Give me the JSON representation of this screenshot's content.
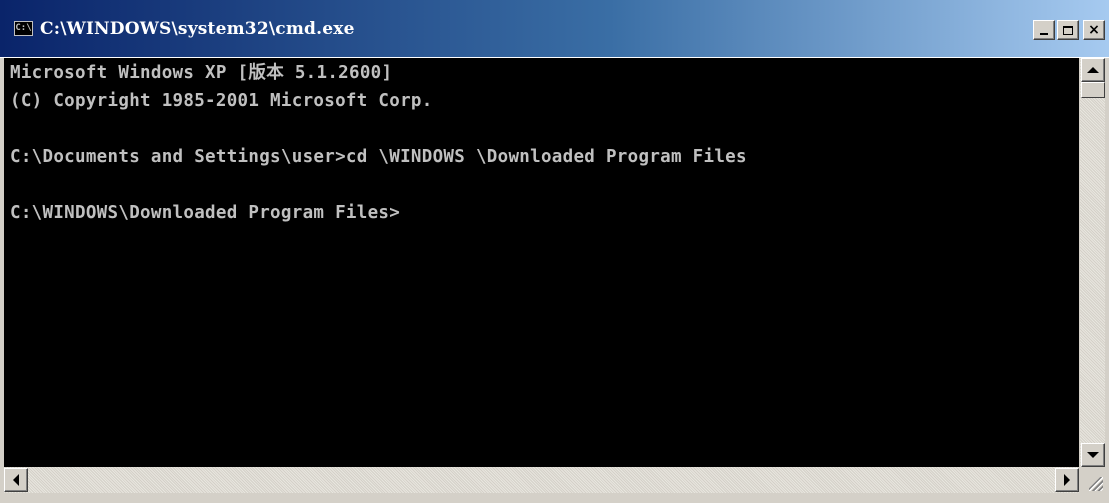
{
  "window": {
    "title": "C:\\WINDOWS\\system32\\cmd.exe",
    "app_icon_label": "C:\\"
  },
  "titlebar": {
    "minimize_icon": "minimize-icon",
    "maximize_icon": "maximize-icon",
    "close_symbol": "×"
  },
  "console": {
    "lines": [
      "Microsoft Windows XP [版本 5.1.2600]",
      "(C) Copyright 1985-2001 Microsoft Corp.",
      "",
      "C:\\Documents and Settings\\user>cd \\WINDOWS \\Downloaded Program Files",
      "",
      "C:\\WINDOWS\\Downloaded Program Files>"
    ],
    "text_color": "#c0c0c0",
    "background_color": "#000000"
  },
  "colors": {
    "titlebar_start": "#0a246a",
    "titlebar_end": "#a6caf0",
    "chrome": "#d4d0c8"
  }
}
